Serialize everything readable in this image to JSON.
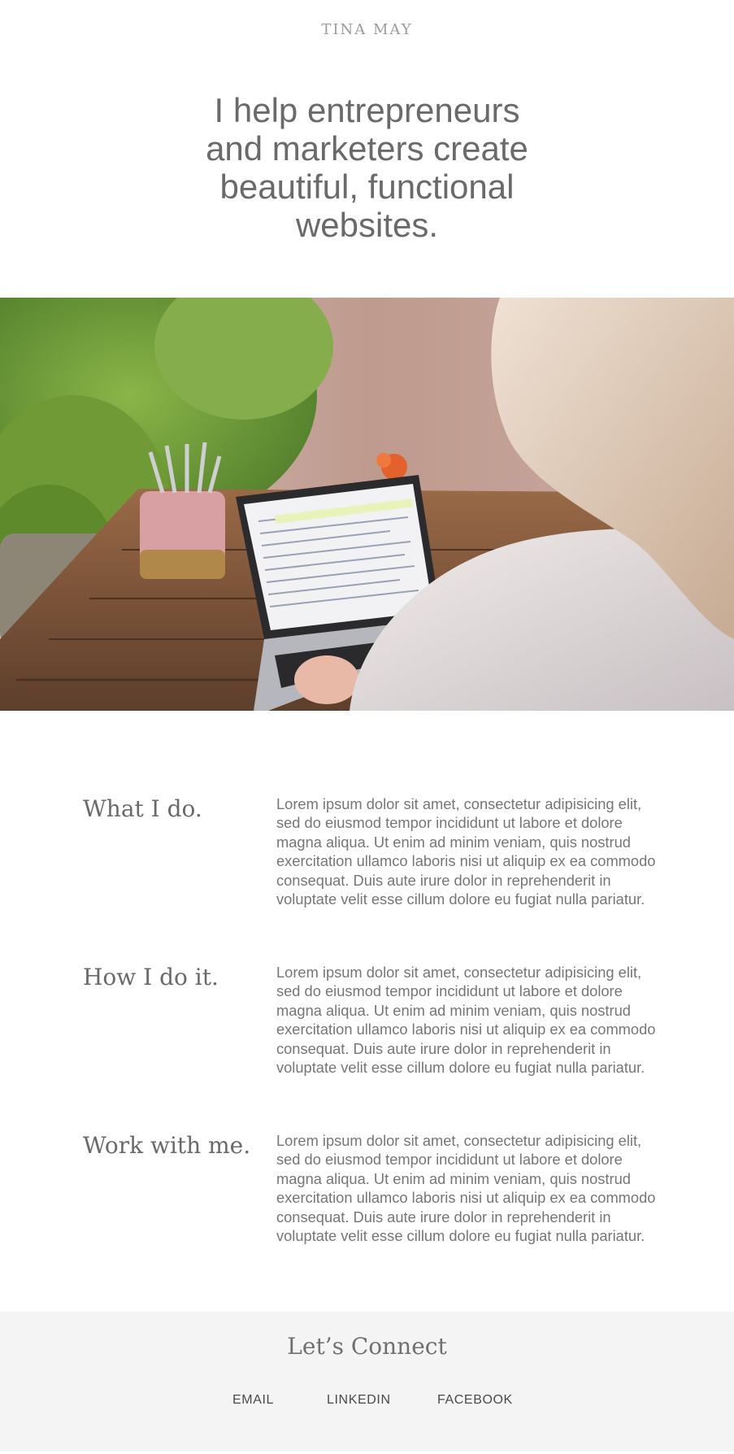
{
  "header": {
    "brand": "TINA MAY"
  },
  "hero": {
    "title": "I help entrepreneurs and marketers create beautiful, functional websites.",
    "image": {
      "alt_icon": "laptop-workspace-photo"
    }
  },
  "sections": [
    {
      "heading": "What I do.",
      "body": "Lorem ipsum dolor sit amet, consectetur adipisicing elit, sed do eiusmod tempor incididunt ut labore et dolore magna aliqua. Ut enim ad minim veniam, quis nostrud exercitation ullamco laboris nisi ut aliquip ex ea commodo consequat. Duis aute irure dolor in reprehenderit in voluptate velit esse cillum dolore eu fugiat nulla pariatur."
    },
    {
      "heading": "How I do it.",
      "body": "Lorem ipsum dolor sit amet, consectetur adipisicing elit, sed do eiusmod tempor incididunt ut labore et dolore magna aliqua. Ut enim ad minim veniam, quis nostrud exercitation ullamco laboris nisi ut aliquip ex ea commodo consequat. Duis aute irure dolor in reprehenderit in voluptate velit esse cillum dolore eu fugiat nulla pariatur."
    },
    {
      "heading": "Work with me.",
      "body": "Lorem ipsum dolor sit amet, consectetur adipisicing elit, sed do eiusmod tempor incididunt ut labore et dolore magna aliqua. Ut enim ad minim veniam, quis nostrud exercitation ullamco laboris nisi ut aliquip ex ea commodo consequat. Duis aute irure dolor in reprehenderit in voluptate velit esse cillum dolore eu fugiat nulla pariatur."
    }
  ],
  "footer": {
    "title": "Let’s Connect",
    "links": [
      "EMAIL",
      "LINKEDIN",
      "FACEBOOK"
    ]
  },
  "colors": {
    "background": "#ffffff",
    "footer_background": "#f4f4f4",
    "text": "#6f6f6f",
    "link": "#4a4a4a"
  }
}
